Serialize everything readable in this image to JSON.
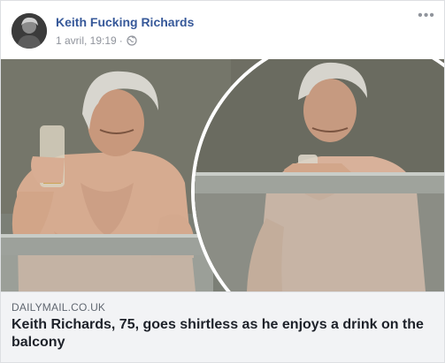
{
  "post": {
    "author": "Keith Fucking Richards",
    "timestamp": "1 avril, 19:19",
    "separator": "·",
    "privacy_icon": "globe-icon",
    "more_label": "•••"
  },
  "link_preview": {
    "domain": "DAILYMAIL.CO.UK",
    "headline": "Keith Richards, 75, goes shirtless as he enjoys a drink on the balcony"
  },
  "colors": {
    "author": "#365899",
    "meta": "#90949c",
    "preview_bg": "#f2f3f5",
    "headline": "#1d2129"
  }
}
